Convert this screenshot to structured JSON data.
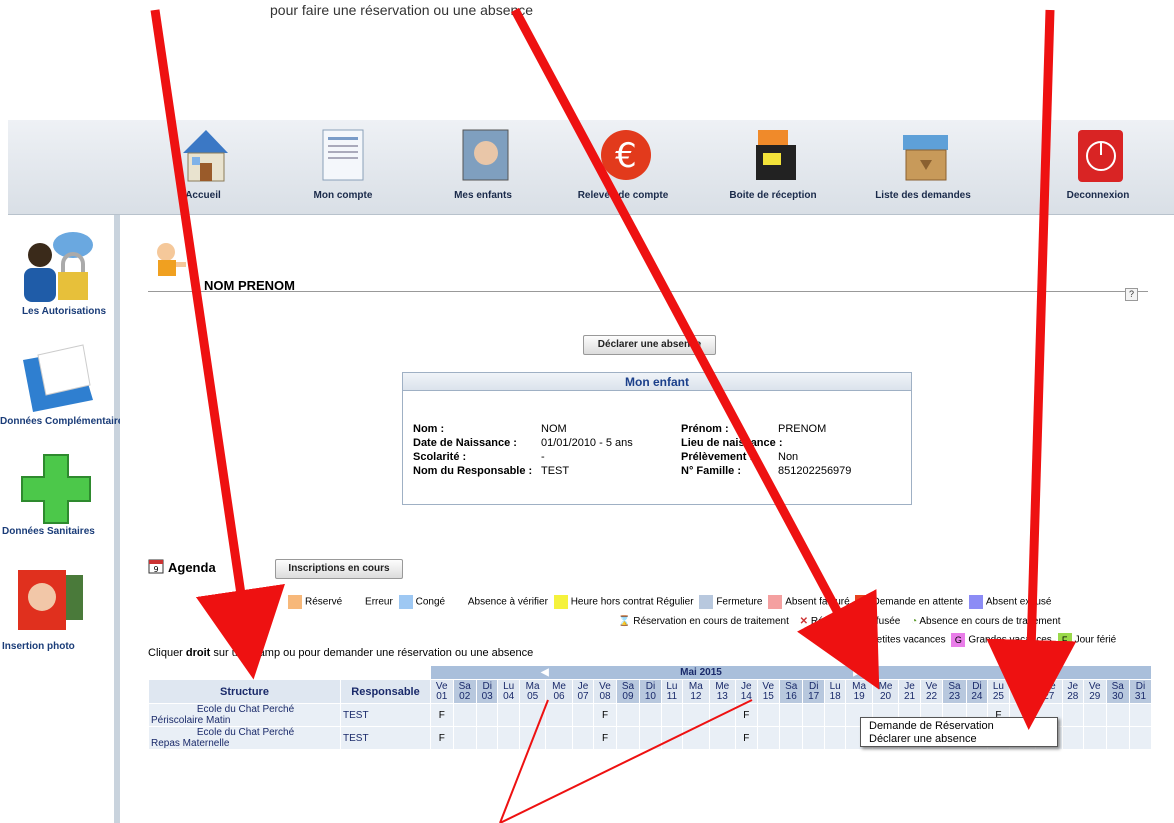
{
  "top_text": "pour  faire  une  réservation  ou  une  absence",
  "nav": [
    {
      "label": "Accueil",
      "icon": "house-icon"
    },
    {
      "label": "Mon compte",
      "icon": "document-icon"
    },
    {
      "label": "Mes enfants",
      "icon": "photo-icon"
    },
    {
      "label": "Relevés de compte",
      "icon": "euro-icon"
    },
    {
      "label": "Boite de réception",
      "icon": "inbox-icon"
    },
    {
      "label": "Liste des demandes",
      "icon": "box-icon"
    },
    {
      "label": "Deconnexion",
      "icon": "power-icon"
    }
  ],
  "sidebar": [
    {
      "label": "Les Autorisations",
      "icon": "user-lock-icon"
    },
    {
      "label": "Données Complémentaires",
      "icon": "folder-icon"
    },
    {
      "label": "Données Sanitaires",
      "icon": "health-cross-icon"
    },
    {
      "label": "Insertion photo",
      "icon": "photo-frame-icon"
    }
  ],
  "child_name": "NOM PRENOM",
  "help": "?",
  "declare_btn": "Déclarer une absence",
  "card": {
    "title": "Mon enfant",
    "nom_label": "Nom :",
    "nom": "NOM",
    "prenom_label": "Prénom :",
    "prenom": "PRENOM",
    "dob_label": "Date de Naissance :",
    "dob": "01/01/2010 - 5 ans",
    "lieu_label": "Lieu de naissance :",
    "lieu": "",
    "scol_label": "Scolarité :",
    "scol": "-",
    "prelev_label": "Prélèvement :",
    "prelev": "Non",
    "resp_label": "Nom du Responsable :",
    "resp": "TEST",
    "famille_label": "N° Famille :",
    "famille": "851202256979"
  },
  "agenda_title": "Agenda",
  "inscriptions_btn": "Inscriptions en cours",
  "legend_row1": [
    {
      "label": "Réservé",
      "color": "#f7b87a"
    },
    {
      "label": "Erreur",
      "color": "#ffffff"
    },
    {
      "label": "Congé",
      "color": "#9ec8f3"
    },
    {
      "label": "Absence à vérifier",
      "color": "#ffffff"
    },
    {
      "label": "Heure hors contrat Régulier",
      "color": "#f5f23c"
    },
    {
      "label": "Fermeture",
      "color": "#b8c8de"
    },
    {
      "label": "Absent facturé",
      "color": "#f4a0a0"
    },
    {
      "label": "Demande en attente",
      "color": "#e8421f"
    },
    {
      "label": "Absent excusé",
      "color": "#8c8cf5"
    }
  ],
  "legend_row2": [
    "Réservation en cours de traitement",
    "Réservation refusée",
    "Absence en cours de traitement"
  ],
  "legend_row3": [
    {
      "letter": "P",
      "label": "Petites vacances",
      "color": "#fbd6b5"
    },
    {
      "letter": "G",
      "label": "Grandes vacances",
      "color": "#e97de9"
    },
    {
      "letter": "F",
      "label": "Jour férié",
      "color": "#9ad94b"
    }
  ],
  "instruction": {
    "pre": "Cliquer ",
    "bold": "droit",
    "post": " sur un champ  ou  pour demander une réservation ou une absence"
  },
  "month": "Mai 2015",
  "col_structure": "Structure",
  "col_resp": "Responsable",
  "days": [
    [
      "Ve",
      "01"
    ],
    [
      "Sa",
      "02"
    ],
    [
      "Di",
      "03"
    ],
    [
      "Lu",
      "04"
    ],
    [
      "Ma",
      "05"
    ],
    [
      "Me",
      "06"
    ],
    [
      "Je",
      "07"
    ],
    [
      "Ve",
      "08"
    ],
    [
      "Sa",
      "09"
    ],
    [
      "Di",
      "10"
    ],
    [
      "Lu",
      "11"
    ],
    [
      "Ma",
      "12"
    ],
    [
      "Me",
      "13"
    ],
    [
      "Je",
      "14"
    ],
    [
      "Ve",
      "15"
    ],
    [
      "Sa",
      "16"
    ],
    [
      "Di",
      "17"
    ],
    [
      "Lu",
      "18"
    ],
    [
      "Ma",
      "19"
    ],
    [
      "Me",
      "20"
    ],
    [
      "Je",
      "21"
    ],
    [
      "Ve",
      "22"
    ],
    [
      "Sa",
      "23"
    ],
    [
      "Di",
      "24"
    ],
    [
      "Lu",
      "25"
    ],
    [
      "Ma",
      "26"
    ],
    [
      "Me",
      "27"
    ],
    [
      "Je",
      "28"
    ],
    [
      "Ve",
      "29"
    ],
    [
      "Sa",
      "30"
    ],
    [
      "Di",
      "31"
    ]
  ],
  "rows": [
    {
      "structure": "Ecole du Chat Perché",
      "sub": "Périscolaire Matin",
      "resp": "TEST"
    },
    {
      "structure": "Ecole du Chat Perché",
      "sub": "Repas Maternelle",
      "resp": "TEST"
    }
  ],
  "ferie_letter": "F",
  "context_menu": [
    "Demande de Réservation",
    "Déclarer une absence"
  ]
}
